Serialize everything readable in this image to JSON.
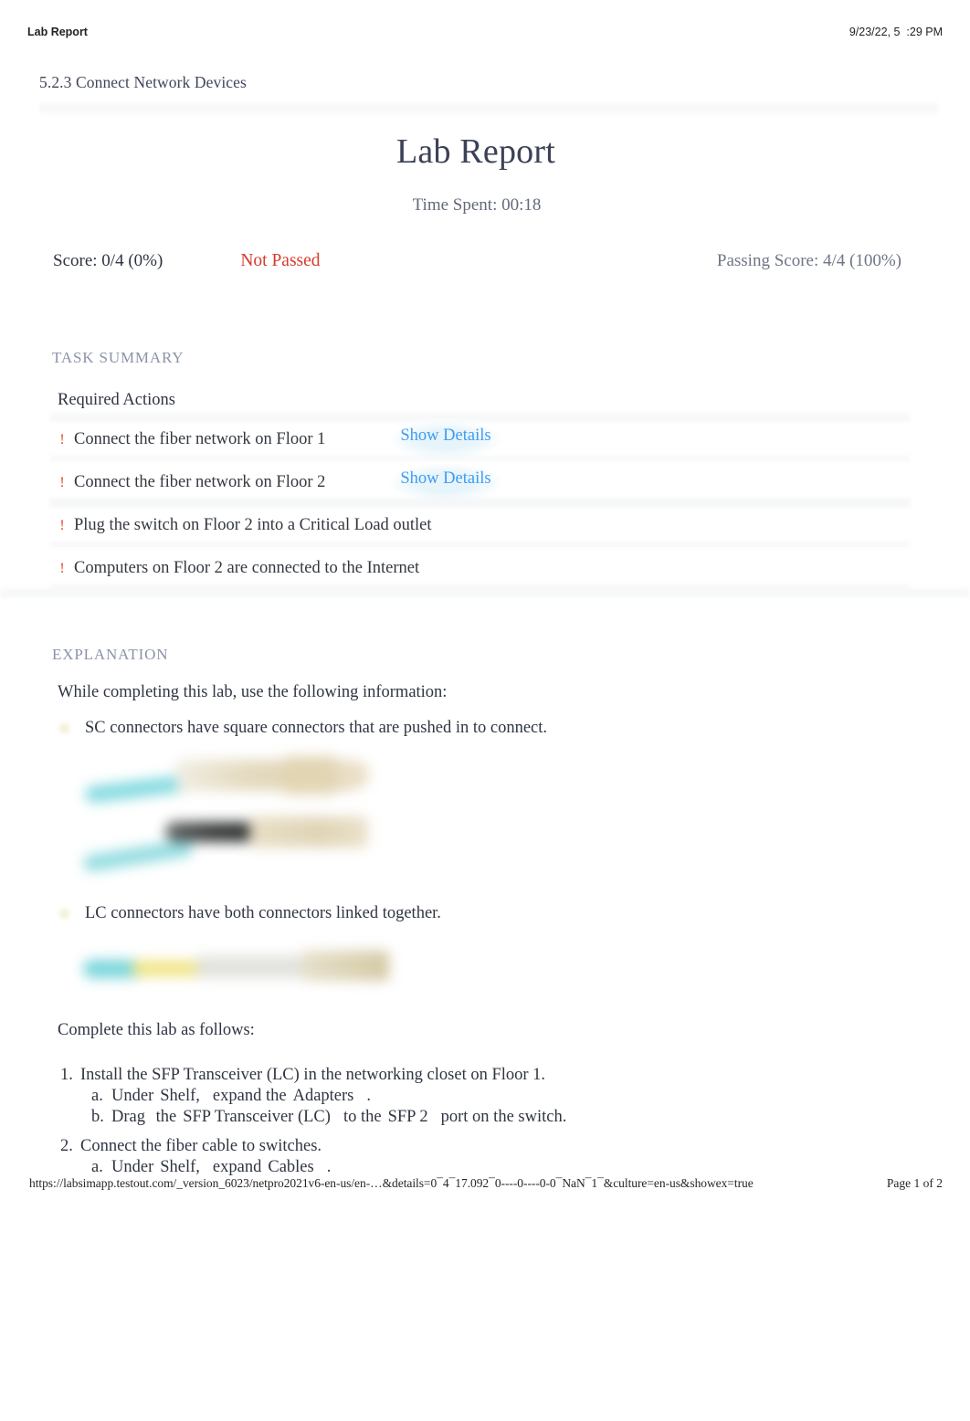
{
  "print_header": {
    "left_title": "Lab Report",
    "timestamp": "9/23/22, 5  :29 PM"
  },
  "breadcrumb": "5.2.3 Connect Network Devices",
  "title": "Lab Report",
  "time_spent": "Time Spent: 00:18",
  "score": {
    "score_text": "Score: 0/4 (0%)",
    "status_text": "Not Passed",
    "passing_text": "Passing Score: 4/4 (100%)",
    "status_color": "#d63a2c"
  },
  "task_summary": {
    "heading": "TASK SUMMARY",
    "subheading": "Required Actions",
    "actions": [
      {
        "icon": "exclamation-icon",
        "text": "Connect the fiber network on Floor 1",
        "details_label": "Show Details",
        "has_details": true
      },
      {
        "icon": "exclamation-icon",
        "text": "Connect the fiber network on Floor 2",
        "details_label": "Show Details",
        "has_details": true
      },
      {
        "icon": "exclamation-icon",
        "text": "Plug the switch on Floor 2 into a Critical Load outlet",
        "details_label": "",
        "has_details": false
      },
      {
        "icon": "exclamation-icon",
        "text": "Computers on Floor 2 are connected to the Internet",
        "details_label": "",
        "has_details": false
      }
    ]
  },
  "explanation": {
    "heading": "EXPLANATION",
    "intro": "While completing this lab, use the following information:",
    "bullet_sc": "SC connectors have square connectors that are pushed in to connect.",
    "bullet_lc": "LC connectors have both connectors linked together.",
    "complete_lab": "Complete this lab as follows:",
    "steps": [
      {
        "num": "1.",
        "parts": [
          {
            "t": "Install the SFP Transceiver (LC) in the networking closet on Floor 1.",
            "bold": false
          }
        ],
        "sub": [
          {
            "num": "a.",
            "parts": [
              {
                "t": "Under",
                "bold": false
              },
              {
                "t": "Shelf,",
                "bold": true
              },
              {
                "t": "expand the",
                "bold": false
              },
              {
                "t": "Adapters",
                "bold": true
              },
              {
                "t": ".",
                "bold": false
              }
            ]
          },
          {
            "num": "b.",
            "parts": [
              {
                "t": "Drag",
                "bold": false
              },
              {
                "t": "the",
                "bold": false
              },
              {
                "t": "SFP Transceiver (LC)",
                "bold": true
              },
              {
                "t": "to the",
                "bold": false
              },
              {
                "t": "SFP 2",
                "bold": true
              },
              {
                "t": "port on the switch.",
                "bold": false
              }
            ]
          }
        ]
      },
      {
        "num": "2.",
        "parts": [
          {
            "t": "Connect the fiber cable to switches.",
            "bold": false
          }
        ],
        "sub": [
          {
            "num": "a.",
            "parts": [
              {
                "t": "Under",
                "bold": false
              },
              {
                "t": "Shelf,",
                "bold": true
              },
              {
                "t": "expand",
                "bold": false
              },
              {
                "t": "Cables",
                "bold": true
              },
              {
                "t": ".",
                "bold": false
              }
            ]
          }
        ]
      }
    ]
  },
  "print_footer": {
    "url": "https://labsimapp.testout.com/_version_6023/netpro2021v6-en-us/en-…&details=0¯4¯17.092¯0----0----0-0¯NaN¯1¯&culture=en-us&showex=true",
    "page": "Page 1 of 2"
  }
}
